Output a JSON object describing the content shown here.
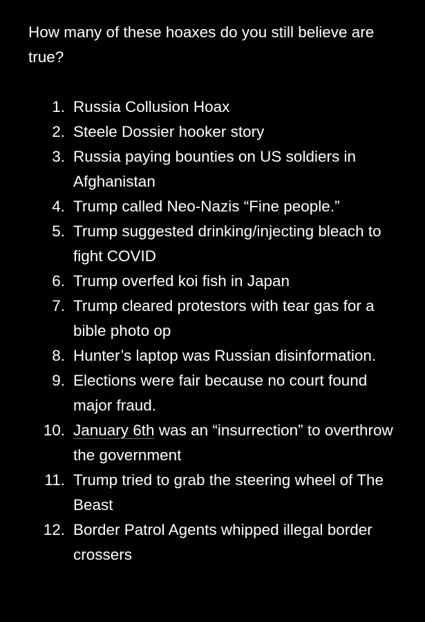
{
  "note": {
    "heading": "How many of these hoaxes do you still believe are true?",
    "items": [
      {
        "num": "1.",
        "text": "Russia Collusion Hoax"
      },
      {
        "num": "2.",
        "text": "Steele Dossier hooker story"
      },
      {
        "num": "3.",
        "text": "Russia paying bounties on US soldiers in Afghanistan"
      },
      {
        "num": "4.",
        "text": "Trump called Neo-Nazis “Fine people.”"
      },
      {
        "num": "5.",
        "text": "Trump suggested drinking/injecting bleach to fight COVID"
      },
      {
        "num": "6.",
        "text": "Trump overfed koi fish in Japan"
      },
      {
        "num": "7.",
        "text": "Trump cleared protestors with tear gas for a bible photo op"
      },
      {
        "num": "8.",
        "text": "Hunter’s laptop was Russian disinformation."
      },
      {
        "num": "9.",
        "text": "Elections were fair because no court found major fraud."
      },
      {
        "num": "10.",
        "link": "January 6th",
        "text": " was an “insurrection” to overthrow the government"
      },
      {
        "num": "11.",
        "text": "Trump tried to grab the steering wheel of The Beast"
      },
      {
        "num": "12.",
        "text": "Border Patrol Agents whipped illegal border crossers"
      }
    ]
  },
  "colors": {
    "background": "#000000",
    "text": "#ffffff",
    "link_underline": "#6b6b6b"
  }
}
